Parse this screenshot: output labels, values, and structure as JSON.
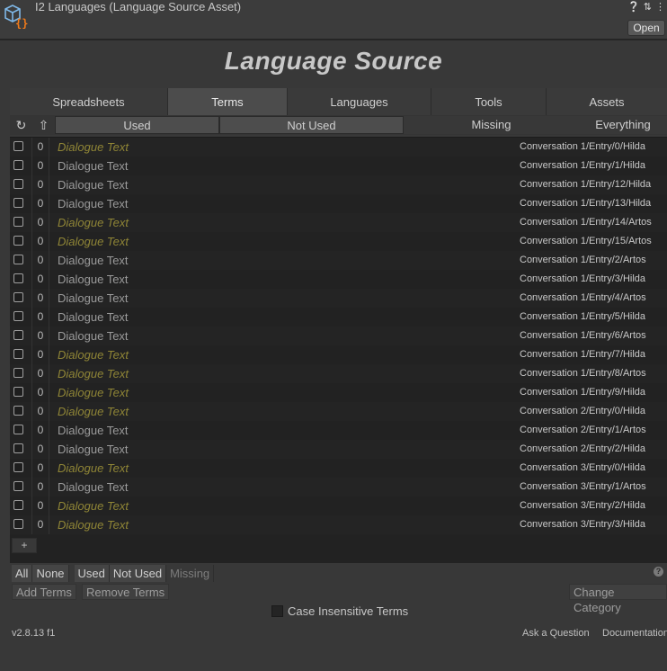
{
  "header": {
    "asset_title": "I2 Languages (Language Source Asset)",
    "open_label": "Open",
    "icons": [
      "help-icon",
      "settings-sliders-icon",
      "more-icon"
    ]
  },
  "title": "Language Source",
  "tabs": [
    {
      "label": "Spreadsheets",
      "active": false
    },
    {
      "label": "Terms",
      "active": true
    },
    {
      "label": "Languages",
      "active": false
    },
    {
      "label": "Tools",
      "active": false
    },
    {
      "label": "Assets",
      "active": false
    }
  ],
  "filters": [
    {
      "label": "Used",
      "on": true
    },
    {
      "label": "Not Used",
      "on": true
    },
    {
      "label": "Missing",
      "on": false
    },
    {
      "label": "Everything",
      "on": false
    }
  ],
  "terms": [
    {
      "count": "0",
      "text": "Dialogue Text",
      "unused": true,
      "key": "Conversation 1/Entry/0/Hilda"
    },
    {
      "count": "0",
      "text": "Dialogue Text",
      "unused": false,
      "key": "Conversation 1/Entry/1/Hilda"
    },
    {
      "count": "0",
      "text": "Dialogue Text",
      "unused": false,
      "key": "Conversation 1/Entry/12/Hilda"
    },
    {
      "count": "0",
      "text": "Dialogue Text",
      "unused": false,
      "key": "Conversation 1/Entry/13/Hilda"
    },
    {
      "count": "0",
      "text": "Dialogue Text",
      "unused": true,
      "key": "Conversation 1/Entry/14/Artos"
    },
    {
      "count": "0",
      "text": "Dialogue Text",
      "unused": true,
      "key": "Conversation 1/Entry/15/Artos"
    },
    {
      "count": "0",
      "text": "Dialogue Text",
      "unused": false,
      "key": "Conversation 1/Entry/2/Artos"
    },
    {
      "count": "0",
      "text": "Dialogue Text",
      "unused": false,
      "key": "Conversation 1/Entry/3/Hilda"
    },
    {
      "count": "0",
      "text": "Dialogue Text",
      "unused": false,
      "key": "Conversation 1/Entry/4/Artos"
    },
    {
      "count": "0",
      "text": "Dialogue Text",
      "unused": false,
      "key": "Conversation 1/Entry/5/Hilda"
    },
    {
      "count": "0",
      "text": "Dialogue Text",
      "unused": false,
      "key": "Conversation 1/Entry/6/Artos"
    },
    {
      "count": "0",
      "text": "Dialogue Text",
      "unused": true,
      "key": "Conversation 1/Entry/7/Hilda"
    },
    {
      "count": "0",
      "text": "Dialogue Text",
      "unused": true,
      "key": "Conversation 1/Entry/8/Artos"
    },
    {
      "count": "0",
      "text": "Dialogue Text",
      "unused": true,
      "key": "Conversation 1/Entry/9/Hilda"
    },
    {
      "count": "0",
      "text": "Dialogue Text",
      "unused": true,
      "key": "Conversation 2/Entry/0/Hilda"
    },
    {
      "count": "0",
      "text": "Dialogue Text",
      "unused": false,
      "key": "Conversation 2/Entry/1/Artos"
    },
    {
      "count": "0",
      "text": "Dialogue Text",
      "unused": false,
      "key": "Conversation 2/Entry/2/Hilda"
    },
    {
      "count": "0",
      "text": "Dialogue Text",
      "unused": true,
      "key": "Conversation 3/Entry/0/Hilda"
    },
    {
      "count": "0",
      "text": "Dialogue Text",
      "unused": false,
      "key": "Conversation 3/Entry/1/Artos"
    },
    {
      "count": "0",
      "text": "Dialogue Text",
      "unused": true,
      "key": "Conversation 3/Entry/2/Hilda"
    },
    {
      "count": "0",
      "text": "Dialogue Text",
      "unused": true,
      "key": "Conversation 3/Entry/3/Hilda"
    }
  ],
  "add_label": "+",
  "selection": {
    "all": "All",
    "none": "None",
    "used": "Used",
    "not_used": "Not Used",
    "missing": "Missing"
  },
  "actions": {
    "add_terms": "Add Terms",
    "remove_terms": "Remove Terms",
    "change_category": "Change Category"
  },
  "case_insensitive_label": "Case Insensitive Terms",
  "footer": {
    "version": "v2.8.13 f1",
    "ask": "Ask a Question",
    "docs": "Documentation"
  }
}
